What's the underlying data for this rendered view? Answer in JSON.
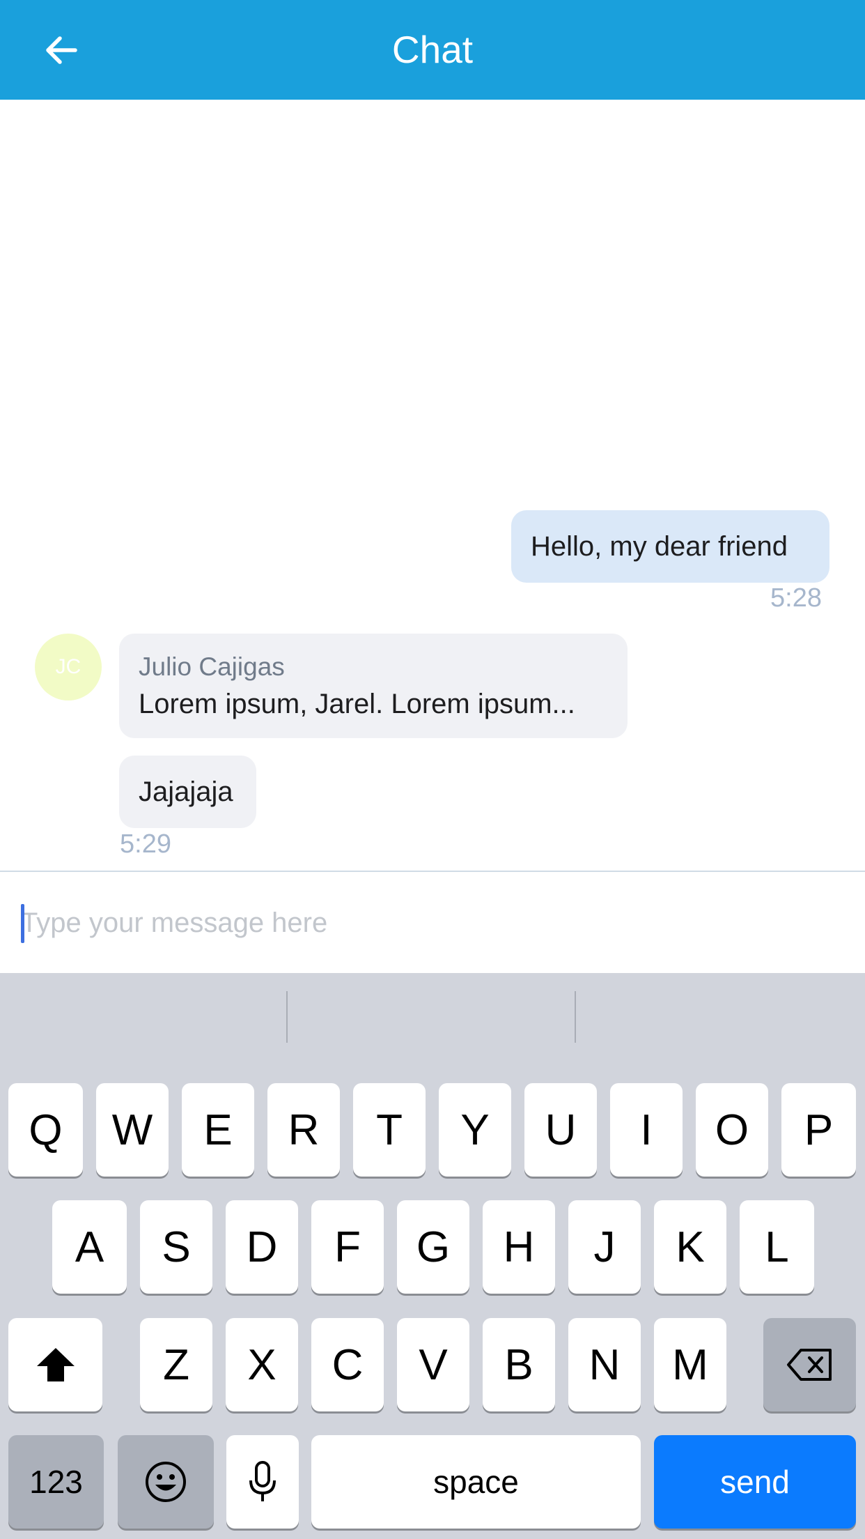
{
  "header": {
    "title": "Chat",
    "back_icon": "arrow-left-icon",
    "background": "#1aa0dc"
  },
  "messages": {
    "outgoing": [
      {
        "text": "Hello, my dear friend",
        "time": "5:28"
      }
    ],
    "incoming": {
      "avatar_initials": "JC",
      "sender": "Julio Cajigas",
      "items": [
        {
          "text": "Lorem ipsum, Jarel. Lorem ipsum..."
        },
        {
          "text": "Jajajaja"
        }
      ],
      "time": "5:29"
    }
  },
  "input": {
    "placeholder": "Type your message here",
    "value": ""
  },
  "keyboard": {
    "row1": [
      "Q",
      "W",
      "E",
      "R",
      "T",
      "Y",
      "U",
      "I",
      "O",
      "P"
    ],
    "row2": [
      "A",
      "S",
      "D",
      "F",
      "G",
      "H",
      "J",
      "K",
      "L"
    ],
    "row3": [
      "Z",
      "X",
      "C",
      "V",
      "B",
      "N",
      "M"
    ],
    "numbers_label": "123",
    "space_label": "space",
    "send_label": "send",
    "shift_icon": "shift-icon",
    "backspace_icon": "backspace-icon",
    "emoji_icon": "emoji-icon",
    "mic_icon": "microphone-icon",
    "send_color": "#0b7bfe"
  }
}
